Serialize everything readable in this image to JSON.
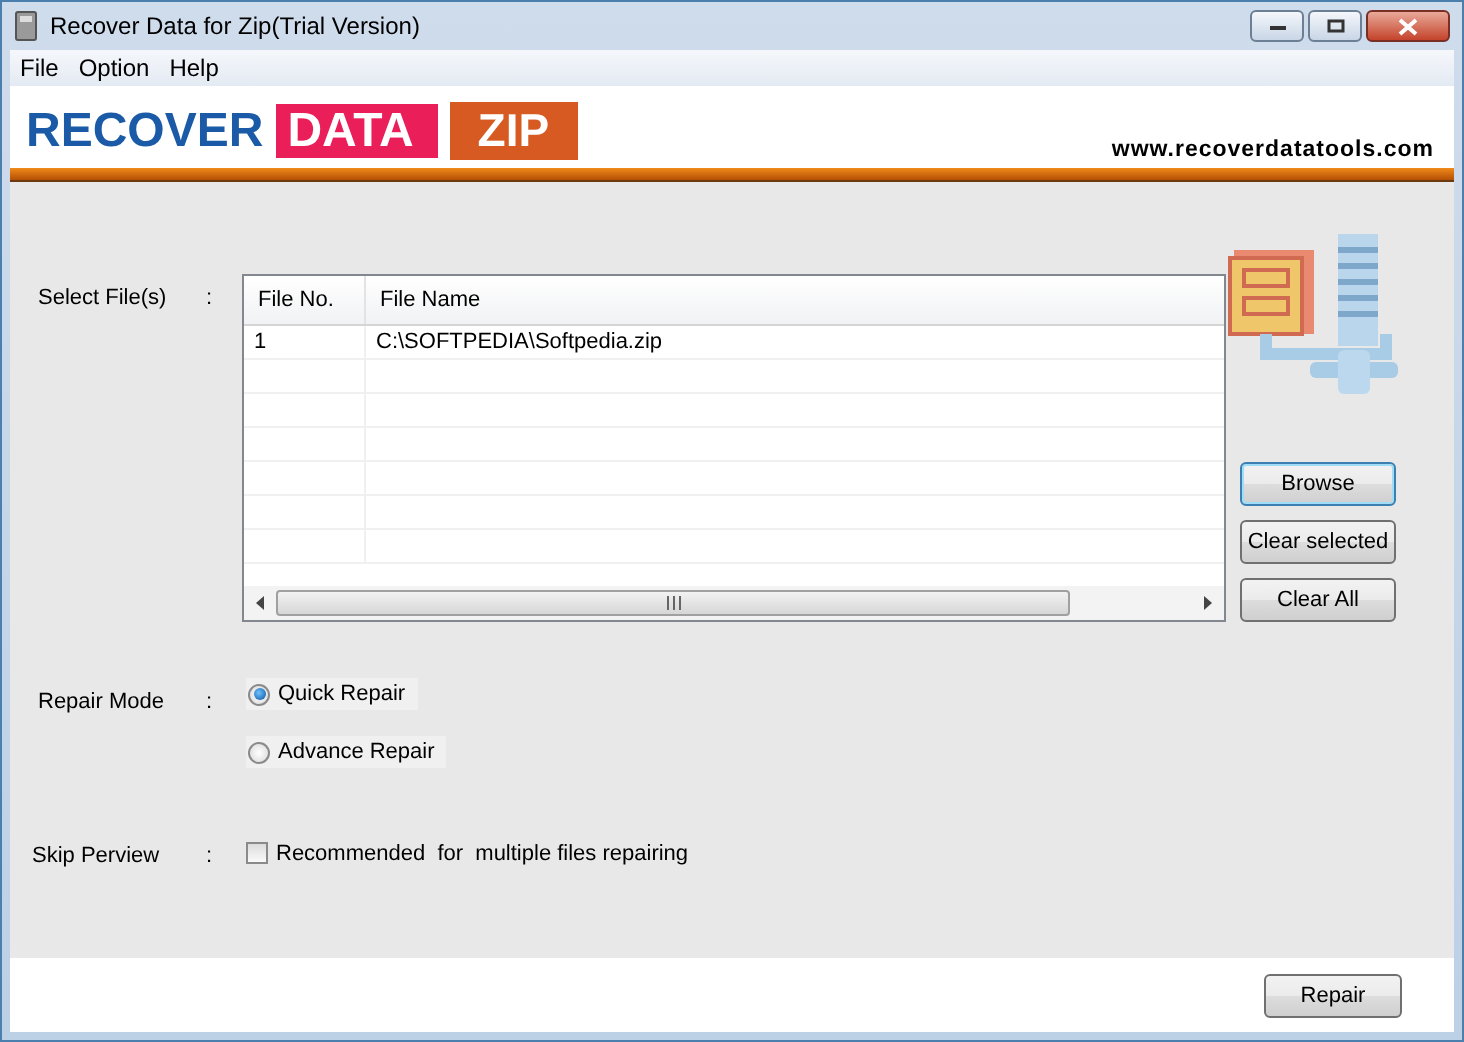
{
  "window": {
    "title": "Recover Data for Zip(Trial Version)"
  },
  "menu": [
    "File",
    "Option",
    "Help"
  ],
  "header": {
    "logo_words": [
      "RECOVER",
      "DATA",
      "ZIP"
    ],
    "url": "www.recoverdatatools.com"
  },
  "select_files": {
    "label": "Select File(s)",
    "separator": ":",
    "table": {
      "columns": [
        "File No.",
        "File Name"
      ],
      "rows": [
        [
          "1",
          "C:\\SOFTPEDIA\\Softpedia.zip"
        ]
      ]
    },
    "buttons": [
      {
        "label": "Browse",
        "focused": true
      },
      {
        "label": "Clear selected",
        "focused": false
      },
      {
        "label": "Clear All",
        "focused": false
      }
    ]
  },
  "repair_mode": {
    "label": "Repair Mode",
    "separator": ":",
    "options": [
      {
        "label": "Quick Repair",
        "selected": true
      },
      {
        "label": "Advance Repair",
        "selected": false
      }
    ]
  },
  "skip_preview": {
    "label": "Skip Perview",
    "separator": ":",
    "checkbox": {
      "label": "Recommended  for  multiple files repairing",
      "checked": false
    }
  },
  "footer": {
    "button": "Repair"
  }
}
